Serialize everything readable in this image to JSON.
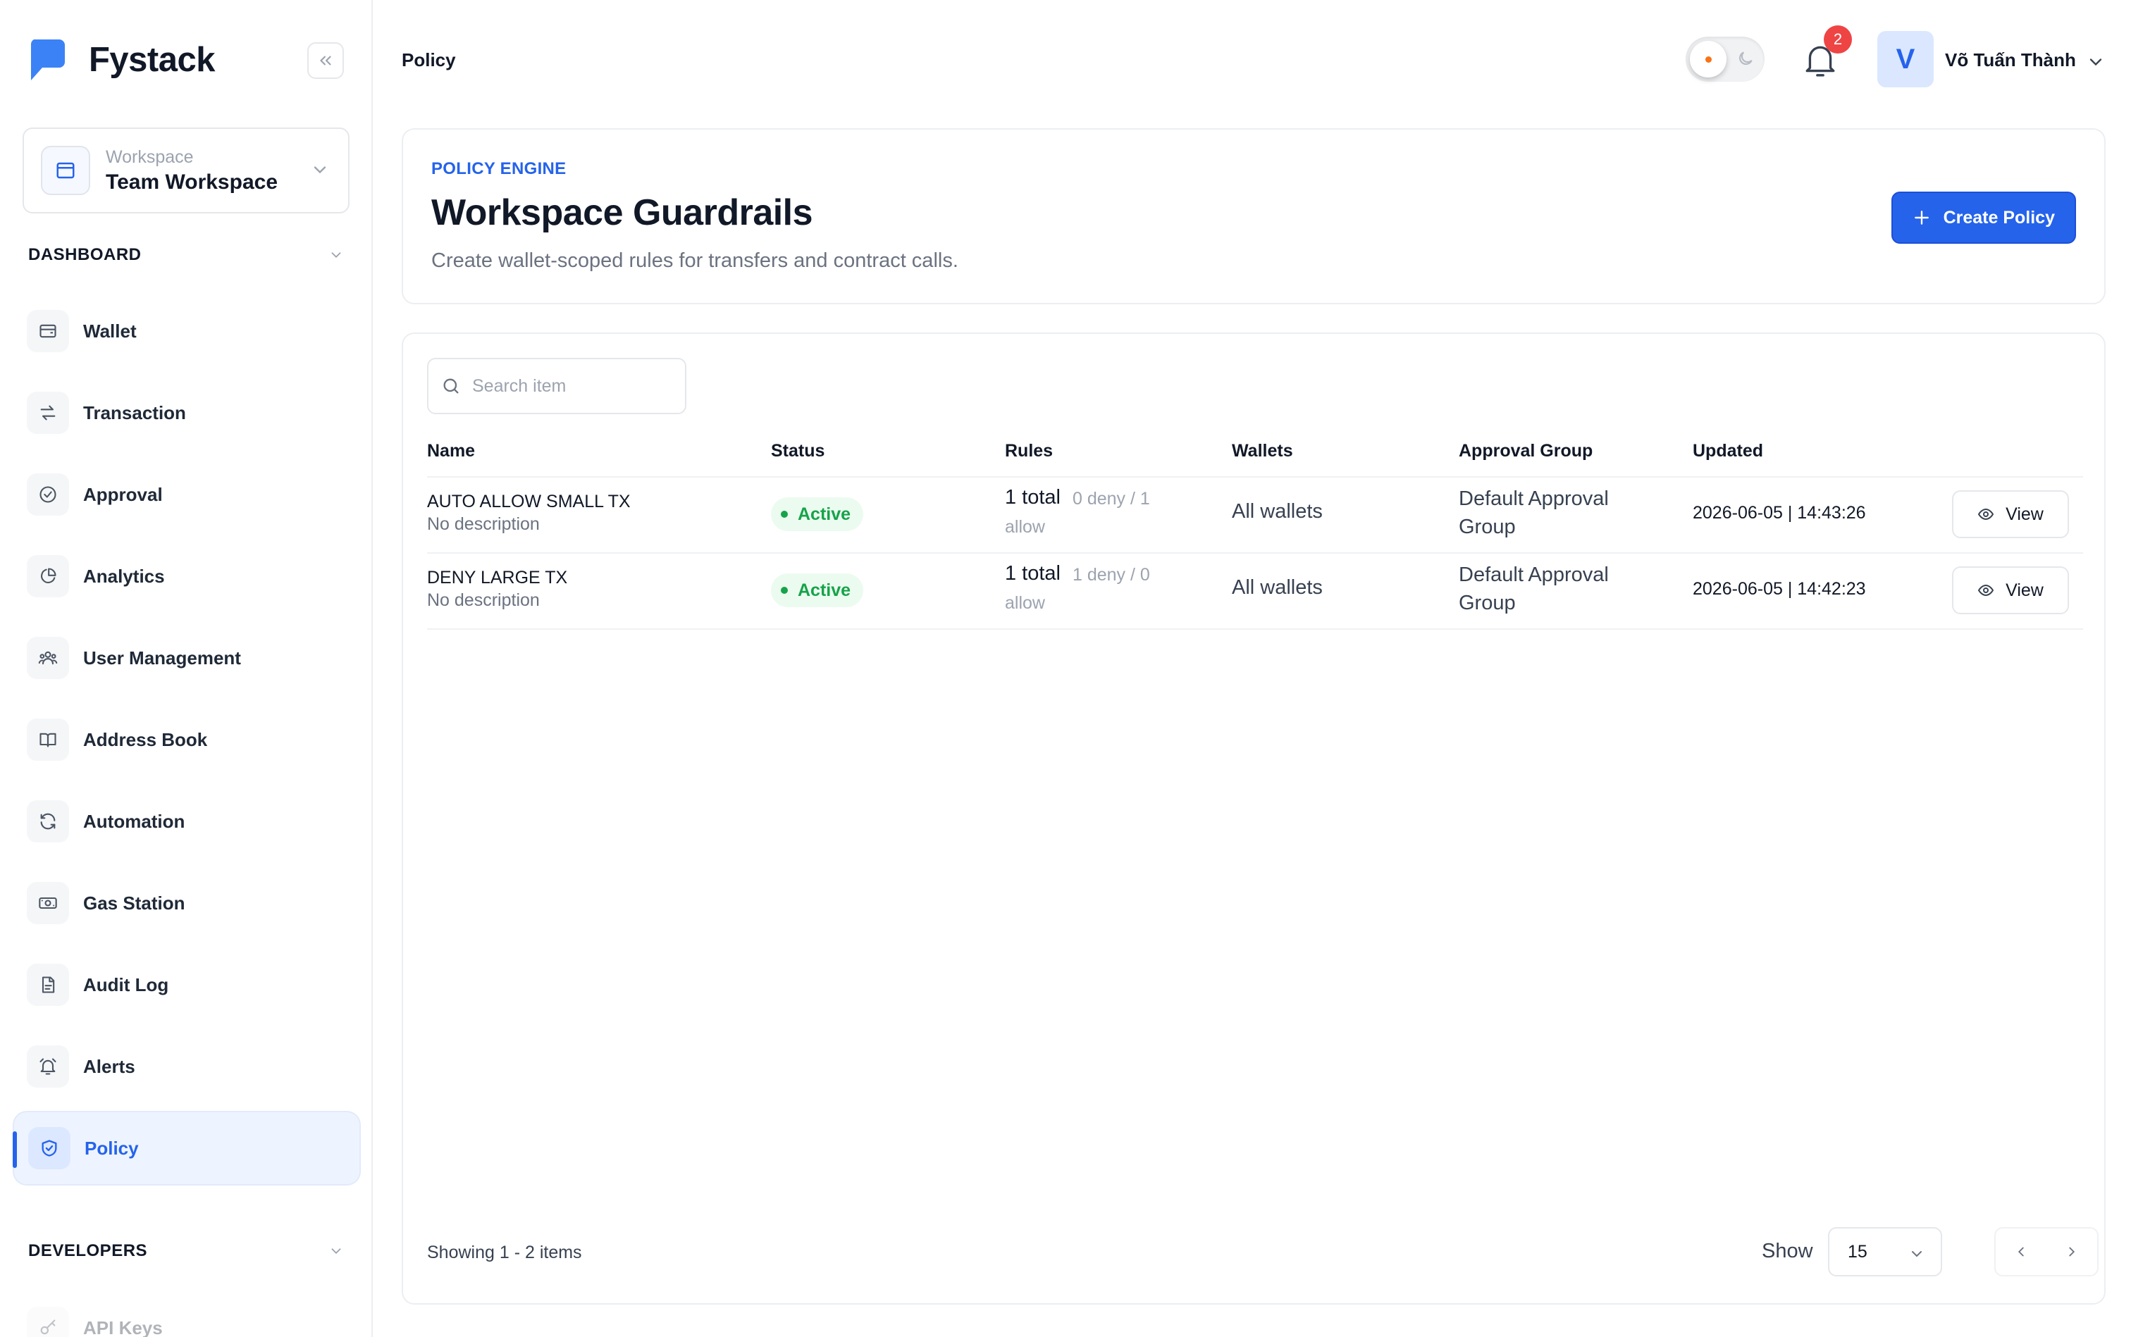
{
  "brand": {
    "name": "Fystack",
    "color": "#3b82f6"
  },
  "workspace": {
    "label": "Workspace",
    "name": "Team Workspace"
  },
  "sections": {
    "dashboard": "DASHBOARD",
    "developers": "DEVELOPERS"
  },
  "nav": {
    "items": [
      {
        "label": "Wallet",
        "icon": "wallet-icon"
      },
      {
        "label": "Transaction",
        "icon": "transfer-icon"
      },
      {
        "label": "Approval",
        "icon": "check-circle-icon"
      },
      {
        "label": "Analytics",
        "icon": "pie-chart-icon"
      },
      {
        "label": "User Management",
        "icon": "users-icon"
      },
      {
        "label": "Address Book",
        "icon": "book-icon"
      },
      {
        "label": "Automation",
        "icon": "refresh-icon"
      },
      {
        "label": "Gas Station",
        "icon": "banknote-icon"
      },
      {
        "label": "Audit Log",
        "icon": "file-icon"
      },
      {
        "label": "Alerts",
        "icon": "alarm-icon"
      },
      {
        "label": "Policy",
        "icon": "shield-check-icon",
        "active": true
      }
    ],
    "developers": [
      {
        "label": "API Keys",
        "icon": "key-icon"
      }
    ]
  },
  "topbar": {
    "breadcrumb": "Policy",
    "notification_count": "2",
    "user": {
      "initial": "V",
      "name": "Võ Tuấn Thành"
    }
  },
  "header": {
    "eyebrow": "POLICY ENGINE",
    "title": "Workspace Guardrails",
    "subtitle": "Create wallet-scoped rules for transfers and contract calls.",
    "create_label": "Create Policy"
  },
  "search": {
    "placeholder": "Search item"
  },
  "table": {
    "columns": [
      "Name",
      "Status",
      "Rules",
      "Wallets",
      "Approval Group",
      "Updated"
    ],
    "rows": [
      {
        "name": "AUTO ALLOW SMALL TX",
        "description": "No description",
        "status": "Active",
        "rules_total": "1 total",
        "rules_detail_1": "0 deny / 1",
        "rules_detail_2": "allow",
        "wallets": "All wallets",
        "group_1": "Default Approval",
        "group_2": "Group",
        "updated": "2026-06-05 | 14:43:26",
        "action": "View"
      },
      {
        "name": "DENY LARGE TX",
        "description": "No description",
        "status": "Active",
        "rules_total": "1 total",
        "rules_detail_1": "1 deny / 0",
        "rules_detail_2": "allow",
        "wallets": "All wallets",
        "group_1": "Default Approval",
        "group_2": "Group",
        "updated": "2026-06-05 | 14:42:23",
        "action": "View"
      }
    ]
  },
  "footer": {
    "showing": "Showing 1 - 2 items",
    "show_label": "Show",
    "page_size": "15"
  },
  "colors": {
    "accent": "#2563eb",
    "success": "#16a34a",
    "badge": "#ef4444"
  }
}
